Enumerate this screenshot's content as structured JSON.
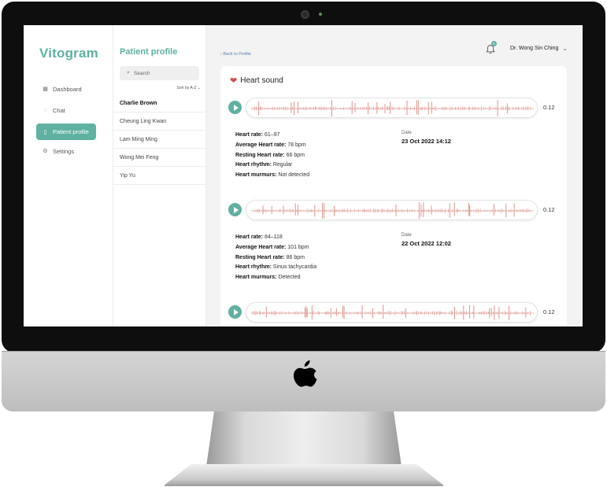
{
  "app": {
    "name": "Vitogram"
  },
  "sidebar": {
    "items": [
      {
        "label": "Dashboard",
        "icon": "grid-icon",
        "active": false
      },
      {
        "label": "Chat",
        "icon": "chat-icon",
        "active": false
      },
      {
        "label": "Patient profile",
        "icon": "file-icon",
        "active": true
      },
      {
        "label": "Settings",
        "icon": "gear-icon",
        "active": false
      }
    ]
  },
  "patient_list": {
    "title": "Patient profile",
    "search_placeholder": "Search",
    "sort_label": "Sort by A-Z",
    "patients": [
      "Charlie Brown",
      "Cheung Ling Kwan",
      "Lam Ming Ming",
      "Wong Mei Feng",
      "Yip Yu"
    ],
    "selected": "Charlie Brown"
  },
  "header": {
    "back_link": "Back to Profile",
    "notification_count": "6",
    "doctor_name": "Dr. Wong Sin Ching"
  },
  "heart_sound": {
    "title": "Heart sound",
    "records": [
      {
        "duration": "0.12",
        "heart_rate_label": "Heart rate:",
        "heart_rate": "61–97",
        "avg_label": "Average Heart rate:",
        "avg": "78 bpm",
        "resting_label": "Resting Heart rate:",
        "resting": "66 bpm",
        "rhythm_label": "Heart rhythm:",
        "rhythm": "Regular",
        "murmurs_label": "Heart murmurs:",
        "murmurs": "Not detected",
        "date_label": "Date",
        "date": "23 Oct 2022 14:12"
      },
      {
        "duration": "0.12",
        "heart_rate_label": "Heart rate:",
        "heart_rate": "84–118",
        "avg_label": "Average Heart rate:",
        "avg": "101 bpm",
        "resting_label": "Resting Heart rate:",
        "resting": "86 bpm",
        "rhythm_label": "Heart rhythm:",
        "rhythm": "Sinus tachycardia",
        "murmurs_label": "Heart murmurs:",
        "murmurs": "Detected",
        "date_label": "Date",
        "date": "22 Oct 2022 12:02"
      },
      {
        "duration": "0.12"
      }
    ]
  },
  "colors": {
    "accent": "#5fb1a2",
    "waveform": "#d98a80",
    "heart": "#d24c4c"
  }
}
